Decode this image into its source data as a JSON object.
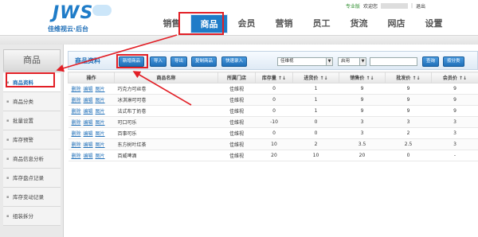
{
  "header": {
    "logo_text": "JWS",
    "logo_sub": "佳维视云·后台",
    "shop_badge": "专业版",
    "welcome": "欢迎您",
    "separator": "|",
    "logout": "退出",
    "nav": [
      "销售",
      "商品",
      "会员",
      "营销",
      "员工",
      "货流",
      "网店",
      "设置"
    ],
    "nav_active_index": 1
  },
  "sidebar": {
    "title": "商品",
    "items": [
      "商品资料",
      "商品分类",
      "批量设置",
      "库存预警",
      "商品信息分析",
      "库存盘点记录",
      "库存变动记录",
      "组装拆分"
    ],
    "active_index": 0
  },
  "main": {
    "title": "商品资料",
    "buttons": {
      "new_product": "新增商品",
      "import": "导入",
      "export": "导出",
      "copy_product": "复制商品",
      "quick_entry": "快速录入",
      "search": "查询",
      "category_search": "按分类"
    },
    "store_select": "佳维视",
    "status_select": "启用",
    "search_placeholder": "",
    "columns": [
      "操作",
      "商品名称",
      "所属门店",
      "库存量 ↑↓",
      "进货价 ↑↓",
      "销售价 ↑↓",
      "批发价 ↑↓",
      "会员价 ↑↓"
    ],
    "ops_labels": [
      "删除",
      "编辑",
      "图片"
    ],
    "rows": [
      {
        "name": "巧克力可丝卷",
        "store": "佳维视",
        "stock": "0",
        "purchase": "1",
        "sale": "9",
        "wholesale": "9",
        "member": "9"
      },
      {
        "name": "冰淇淋可可卷",
        "store": "佳维视",
        "stock": "0",
        "purchase": "1",
        "sale": "9",
        "wholesale": "9",
        "member": "9"
      },
      {
        "name": "法式布丁奶卷",
        "store": "佳维视",
        "stock": "0",
        "purchase": "1",
        "sale": "9",
        "wholesale": "9",
        "member": "9"
      },
      {
        "name": "可口可乐",
        "store": "佳维视",
        "stock": "-10",
        "purchase": "0",
        "sale": "3",
        "wholesale": "3",
        "member": "3"
      },
      {
        "name": "百事可乐",
        "store": "佳维视",
        "stock": "0",
        "purchase": "0",
        "sale": "3",
        "wholesale": "2",
        "member": "3"
      },
      {
        "name": "东方树叶红茶",
        "store": "佳维视",
        "stock": "10",
        "purchase": "2",
        "sale": "3.5",
        "wholesale": "2.5",
        "member": "3"
      },
      {
        "name": "百威啤酒",
        "store": "佳维视",
        "stock": "20",
        "purchase": "10",
        "sale": "20",
        "wholesale": "0",
        "member": "-"
      }
    ]
  },
  "colors": {
    "accent": "#1f7cc8",
    "highlight": "#e21f26"
  }
}
